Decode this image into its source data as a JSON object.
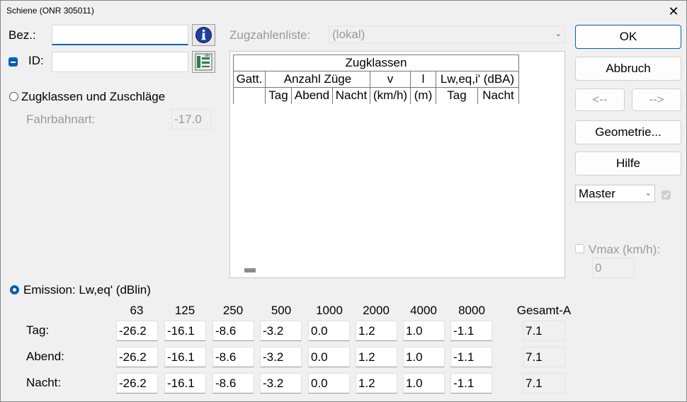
{
  "window": {
    "title": "Schiene (ONR 305011)",
    "close_glyph": "✕"
  },
  "bez": {
    "label": "Bez.:",
    "value": ""
  },
  "id_field": {
    "label": "ID:",
    "value": ""
  },
  "zugklassen_option": {
    "label": "Zugklassen und Zuschläge"
  },
  "fahrbahnart": {
    "label": "Fahrbahnart:",
    "value": "-17.0"
  },
  "zugzahlenliste": {
    "label": "Zugzahlenliste:",
    "value": "(lokal)"
  },
  "zug_table": {
    "title": "Zugklassen",
    "header1": [
      "Gatt.",
      "Anzahl Züge",
      "v",
      "l",
      "Lw,eq,i' (dBA)"
    ],
    "header2": [
      "Tag",
      "Abend",
      "Nacht",
      "(km/h)",
      "(m)",
      "Tag",
      "Nacht"
    ]
  },
  "buttons": {
    "ok": "OK",
    "abbruch": "Abbruch",
    "prev": "<--",
    "next": "-->",
    "geometrie": "Geometrie...",
    "hilfe": "Hilfe"
  },
  "master": {
    "value": "Master"
  },
  "vmax": {
    "label": "Vmax (km/h):",
    "value": "0"
  },
  "emission": {
    "label": "Emission: Lw,eq' (dBlin)",
    "frequencies": [
      "63",
      "125",
      "250",
      "500",
      "1000",
      "2000",
      "4000",
      "8000"
    ],
    "total_header": "Gesamt-A",
    "rows": [
      {
        "label": "Tag:",
        "values": [
          "-26.2",
          "-16.1",
          "-8.6",
          "-3.2",
          "0.0",
          "1.2",
          "1.0",
          "-1.1"
        ],
        "total": "7.1"
      },
      {
        "label": "Abend:",
        "values": [
          "-26.2",
          "-16.1",
          "-8.6",
          "-3.2",
          "0.0",
          "1.2",
          "1.0",
          "-1.1"
        ],
        "total": "7.1"
      },
      {
        "label": "Nacht:",
        "values": [
          "-26.2",
          "-16.1",
          "-8.6",
          "-3.2",
          "0.0",
          "1.2",
          "1.0",
          "-1.1"
        ],
        "total": "7.1"
      }
    ]
  },
  "colors": {
    "accent": "#005fb8",
    "info_icon": "#1f3f9a",
    "list_icon": "#2e7d4f"
  }
}
